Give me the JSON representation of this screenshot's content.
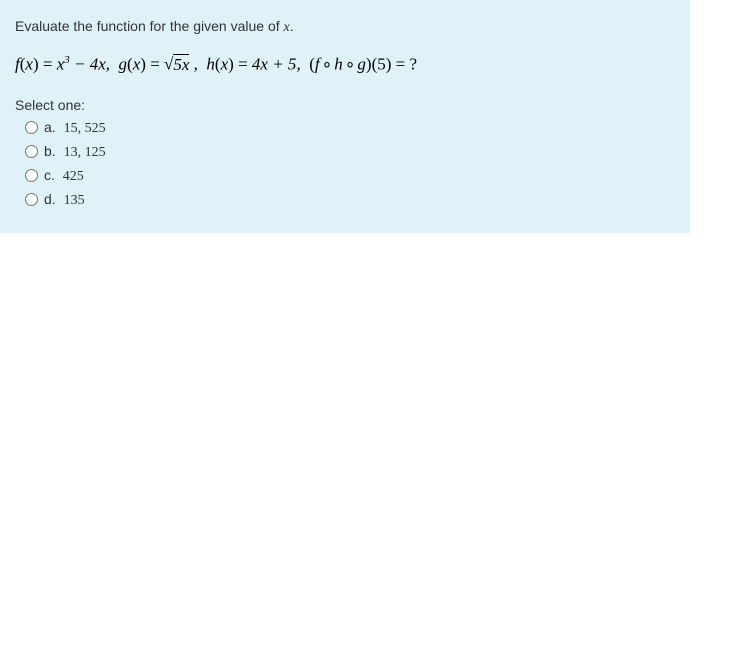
{
  "question": {
    "prompt": "Evaluate the function for the given value of x.",
    "expression_parts": {
      "f_label": "f",
      "g_label": "g",
      "h_label": "h",
      "var": "x",
      "f_body_1": "x",
      "f_exp": "3",
      "f_body_2": " − 4x",
      "g_sqrt_inner": "5x",
      "h_body": "4x + 5",
      "compose": "(f ∘ h ∘ g)(5) = ?"
    },
    "select_text": "Select one:",
    "options": [
      {
        "letter": "a.",
        "value": "15, 525"
      },
      {
        "letter": "b.",
        "value": "13, 125"
      },
      {
        "letter": "c.",
        "value": "425"
      },
      {
        "letter": "d.",
        "value": "135"
      }
    ]
  }
}
